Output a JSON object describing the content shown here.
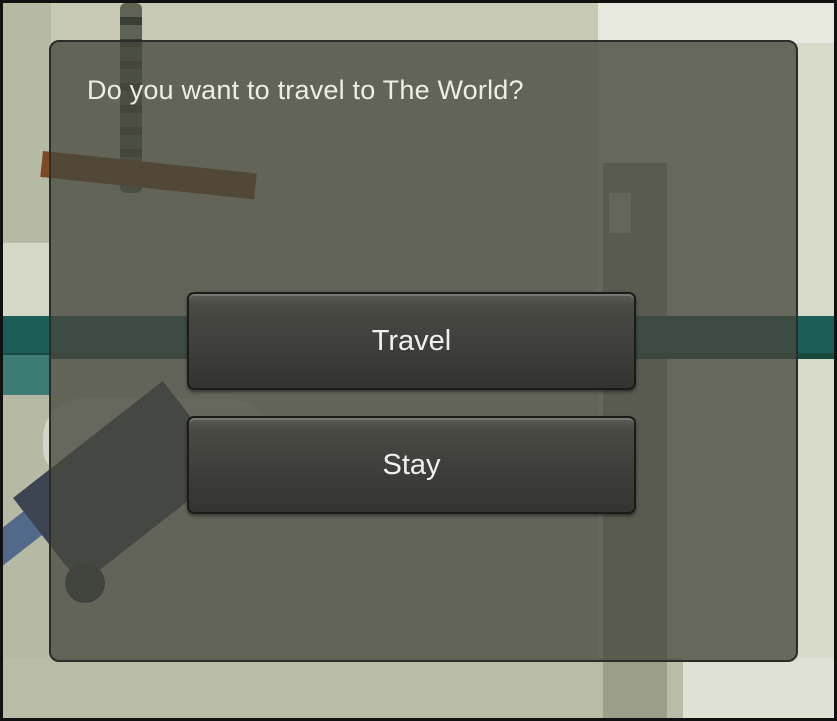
{
  "dialog": {
    "title": "Do you want to travel to The World?",
    "buttons": {
      "travel_label": "Travel",
      "stay_label": "Stay"
    }
  },
  "colors": {
    "panel_overlay": "#46483e",
    "button_face": "#3d3d39",
    "text": "#eceee6",
    "teal_background_bar": "#1d5d57"
  }
}
